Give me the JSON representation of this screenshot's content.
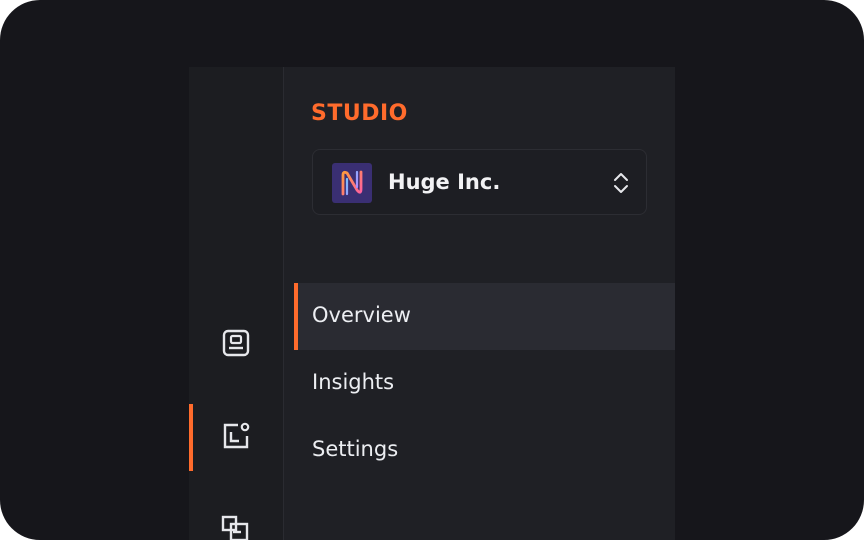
{
  "brand": {
    "name": "STUDIO",
    "color": "#ff6b2c"
  },
  "organization": {
    "name": "Huge Inc.",
    "logo_icon": "huge-logo-icon",
    "switcher_icon": "chevron-up-down-icon"
  },
  "rail": {
    "items": [
      {
        "icon": "profile-card-icon",
        "active": false
      },
      {
        "icon": "dashboard-user-icon",
        "active": true
      },
      {
        "icon": "layers-icon",
        "active": false
      }
    ]
  },
  "nav": {
    "items": [
      {
        "label": "Overview",
        "active": true
      },
      {
        "label": "Insights",
        "active": false
      },
      {
        "label": "Settings",
        "active": false
      }
    ]
  }
}
